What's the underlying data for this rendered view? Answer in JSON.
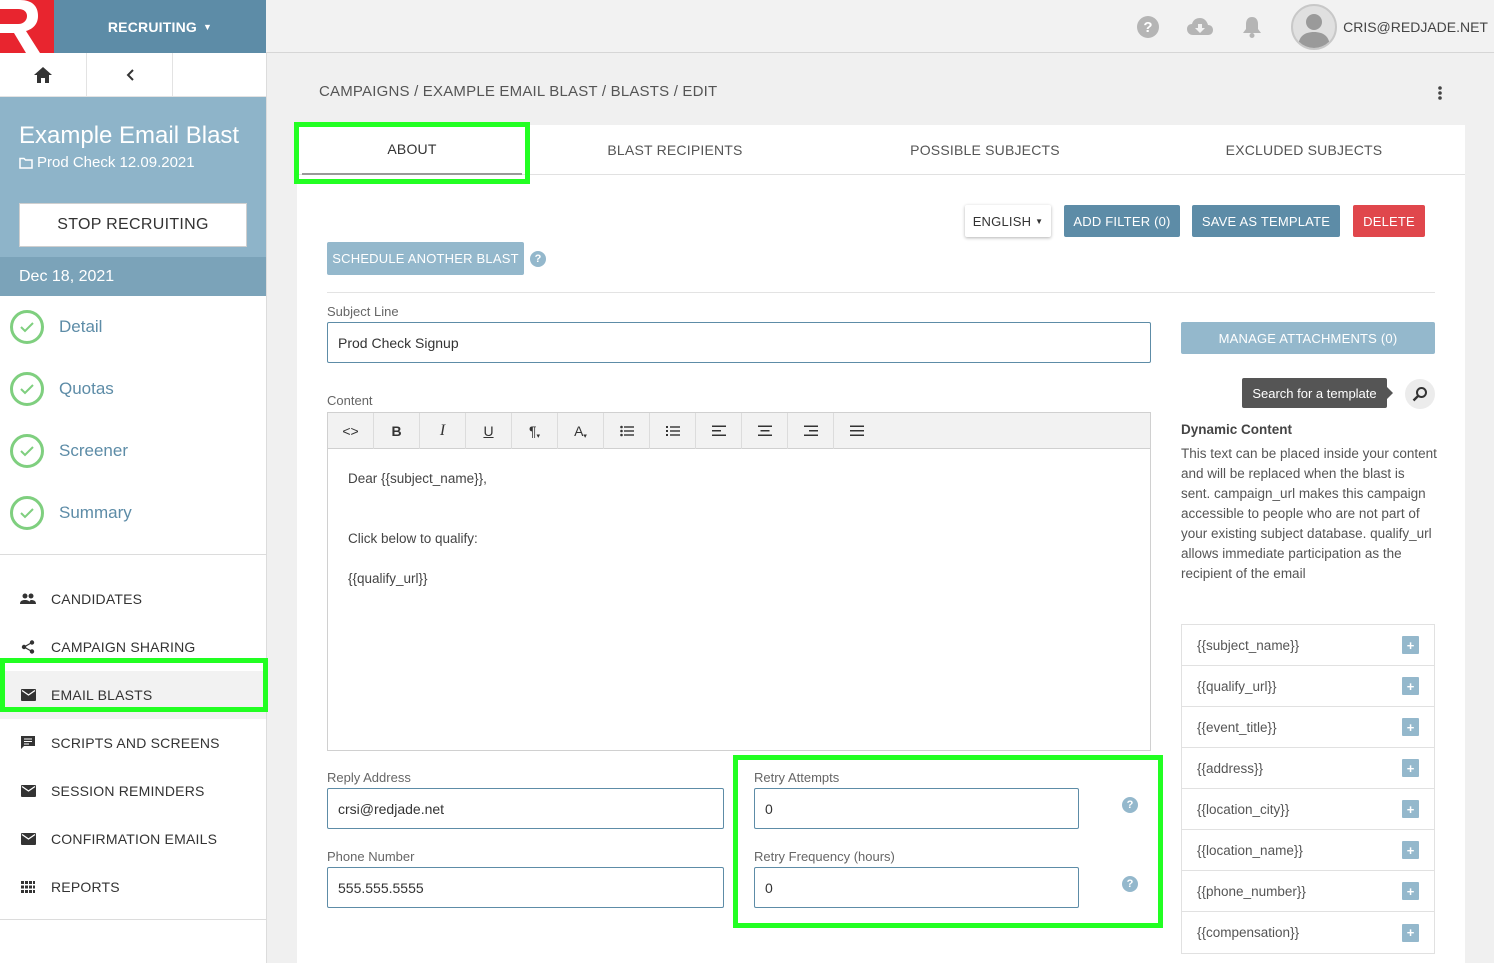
{
  "app": {
    "module_label": "RECRUITING",
    "user_email": "CRIS@REDJADE.NET"
  },
  "campaign": {
    "title": "Example Email Blast",
    "folder": "Prod Check 12.09.2021",
    "stop_label": "STOP RECRUITING",
    "date": "Dec 18, 2021"
  },
  "steps": [
    "Detail",
    "Quotas",
    "Screener",
    "Summary"
  ],
  "menu": [
    {
      "label": "CANDIDATES",
      "icon": "people-icon"
    },
    {
      "label": "CAMPAIGN SHARING",
      "icon": "share-icon"
    },
    {
      "label": "EMAIL BLASTS",
      "icon": "mail-icon"
    },
    {
      "label": "SCRIPTS AND SCREENS",
      "icon": "comment-icon"
    },
    {
      "label": "SESSION REMINDERS",
      "icon": "mail-icon"
    },
    {
      "label": "CONFIRMATION EMAILS",
      "icon": "mail-icon"
    },
    {
      "label": "REPORTS",
      "icon": "grid-icon"
    }
  ],
  "breadcrumb": "CAMPAIGNS / EXAMPLE EMAIL BLAST / BLASTS / EDIT",
  "tabs": [
    "ABOUT",
    "BLAST RECIPIENTS",
    "POSSIBLE SUBJECTS",
    "EXCLUDED SUBJECTS"
  ],
  "actions": {
    "language": "ENGLISH",
    "add_filter": "ADD FILTER (0)",
    "save_template": "SAVE AS TEMPLATE",
    "delete": "DELETE",
    "schedule": "SCHEDULE ANOTHER BLAST",
    "manage_attachments": "MANAGE ATTACHMENTS (0)"
  },
  "form": {
    "subject_label": "Subject Line",
    "subject_value": "Prod Check Signup",
    "content_label": "Content",
    "content_lines": [
      "Dear {{subject_name}},",
      "",
      "Click below to qualify:",
      "{{qualify_url}}"
    ],
    "reply_label": "Reply Address",
    "reply_value": "crsi@redjade.net",
    "phone_label": "Phone Number",
    "phone_value": "555.555.5555",
    "retry_attempts_label": "Retry Attempts",
    "retry_attempts_value": "0",
    "retry_freq_label": "Retry Frequency (hours)",
    "retry_freq_value": "0"
  },
  "toolbar": [
    "<>",
    "B",
    "I",
    "U",
    "¶",
    "A"
  ],
  "template_search": {
    "tooltip": "Search for a template"
  },
  "dynamic": {
    "title": "Dynamic Content",
    "text": "This text can be placed inside your content and will be replaced when the blast is sent. campaign_url makes this campaign accessible to people who are not part of your existing subject database. qualify_url allows immediate participation as the recipient of the email",
    "tokens": [
      "{{subject_name}}",
      "{{qualify_url}}",
      "{{event_title}}",
      "{{address}}",
      "{{location_city}}",
      "{{location_name}}",
      "{{phone_number}}",
      "{{compensation}}"
    ]
  },
  "colors": {
    "brand_red": "#e8252f",
    "primary": "#5d8ca7",
    "highlight": "#22ff22",
    "danger": "#e0474c"
  }
}
